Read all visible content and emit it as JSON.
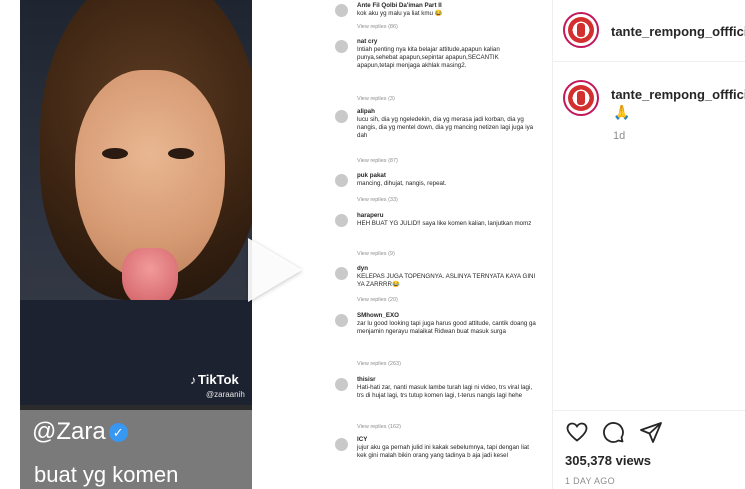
{
  "video": {
    "tiktok_badge": "TikTok",
    "tiktok_user": "@zaraanih",
    "caption_user": "@Zara",
    "caption_line": "buat yg komen"
  },
  "comments_image": {
    "items": [
      {
        "name": "Ante Fil Qolbi Da'iman Part II",
        "text": "kok aku yg malu ya liat kmu 😂",
        "replies": ""
      },
      {
        "name": "",
        "text": "",
        "replies": "View replies (86)"
      },
      {
        "name": "nat cry",
        "text": "Intiah penting nya kita belajar attitude,apapun kalian punya,sehebat apapun,sepintar apapun,SECANTIK apapun,tetapi menjaga akhlak masing2.",
        "replies": "View replies (3)"
      },
      {
        "name": "alipah",
        "text": "lucu sih, dia yg ngeledekin, dia yg merasa jadi korban, dia yg nangis, dia yg mentel down, dia yg mancing netizen lagi juga iya dah",
        "replies": "View replies (87)"
      },
      {
        "name": "puk pakat",
        "text": "mancing, dihujat, nangis, repeat.",
        "replies": "View replies (33)"
      },
      {
        "name": "haraperu",
        "text": "HEH BUAT YG JULID!! saya like komen kalian, lanjutkan momz",
        "replies": "View replies (9)"
      },
      {
        "name": "dyn",
        "text": "KELEPAS JUGA TOPENGNYA. ASLINYA TERNYATA KAYA GINI YA ZARRRR😂",
        "replies": "View replies (20)"
      },
      {
        "name": "SMhown_EXO",
        "text": "zar lu good looking tapi juga harus good attitude, cantik doang ga menjamin ngerayu malaikat Ridwan buat masuk surga",
        "replies": "View replies (263)"
      },
      {
        "name": "thisisr",
        "text": "Hati-hati zar, nanti masuk lambe turah lagi ni video, trs viral lagi, trs di hujat lagi, trs tutup komen lagi, t-terus nangis lagi hehe",
        "replies": "View replies (162)"
      },
      {
        "name": "ICY",
        "text": "jujur aku ga pernah julid ini kakak sebelumnya, tapi dengan liat kek gini malah bikin orang yang tadinya b aja jadi kesel",
        "replies": ""
      }
    ]
  },
  "panel": {
    "header_username": "tante_rempong_offficial",
    "caption_username": "tante_rempong_offficial",
    "caption_emoji": "🙏",
    "caption_time": "1d",
    "views": "305,378 views",
    "date": "1 DAY AGO"
  },
  "icons": [
    "play-icon",
    "heart-icon",
    "comment-icon",
    "share-icon",
    "verified-icon"
  ],
  "colors": {
    "accent": "#3897f0",
    "avatar_ring": "#c2185b",
    "muted_text": "#8e8e8e"
  }
}
